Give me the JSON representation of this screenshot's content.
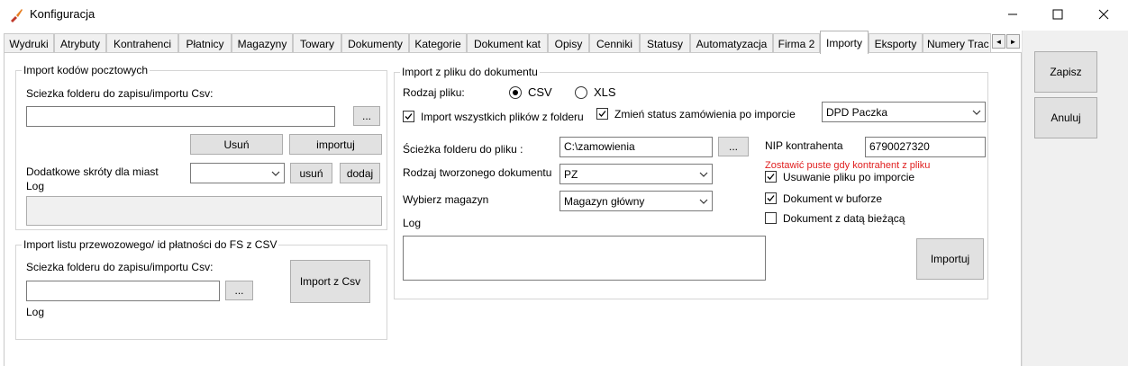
{
  "window": {
    "title": "Konfiguracja",
    "minimize_icon": "minimize-icon",
    "maximize_icon": "maximize-icon",
    "close_icon": "close-icon",
    "app_icon": "brush-icon"
  },
  "tabs": [
    {
      "label": "Wydruki"
    },
    {
      "label": "Atrybuty"
    },
    {
      "label": "Kontrahenci"
    },
    {
      "label": "Płatnicy"
    },
    {
      "label": "Magazyny"
    },
    {
      "label": "Towary"
    },
    {
      "label": "Dokumenty"
    },
    {
      "label": "Kategorie"
    },
    {
      "label": "Dokument kat"
    },
    {
      "label": "Opisy"
    },
    {
      "label": "Cenniki"
    },
    {
      "label": "Statusy"
    },
    {
      "label": "Automatyzacja"
    },
    {
      "label": "Firma 2"
    },
    {
      "label": "Importy",
      "active": true
    },
    {
      "label": "Eksporty"
    },
    {
      "label": "Numery Trac"
    }
  ],
  "tab_scroll": {
    "left": "◄",
    "right": "►"
  },
  "postal": {
    "group_title": "Import kodów pocztowych",
    "path_label": "Sciezka folderu do zapisu/importu Csv:",
    "path_value": "",
    "browse": "...",
    "remove": "Usuń",
    "import": "importuj",
    "shortcuts_label": "Dodatkowe skróty dla miast",
    "shortcuts_value": "",
    "shortcut_remove": "usuń",
    "shortcut_add": "dodaj",
    "log_label": "Log"
  },
  "waybill": {
    "group_title": "Import listu przewozowego/ id płatności do FS z CSV",
    "path_label": "Sciezka folderu do zapisu/importu Csv:",
    "path_value": "",
    "browse": "...",
    "import_button": "Import z Csv",
    "log_label": "Log"
  },
  "docimport": {
    "group_title": "Import z pliku do dokumentu",
    "file_type_label": "Rodzaj pliku:",
    "radio_csv": "CSV",
    "radio_xls": "XLS",
    "file_type_selected": "CSV",
    "import_all_label": "Import wszystkich plików z folderu",
    "import_all_checked": true,
    "change_status_label": "Zmień status zamówienia po imporcie",
    "change_status_checked": true,
    "status_value": "DPD Paczka",
    "path_label": "Ścieżka folderu do pliku :",
    "path_value": "C:\\zamowienia",
    "browse": "...",
    "nip_label": "NIP kontrahenta",
    "nip_value": "6790027320",
    "nip_hint": "Zostawić puste gdy kontrahent z pliku",
    "doc_type_label": "Rodzaj tworzonego dokumentu",
    "doc_type_value": "PZ",
    "warehouse_label": "Wybierz magazyn",
    "warehouse_value": "Magazyn główny",
    "delete_file_label": "Usuwanie pliku po imporcie",
    "delete_file_checked": true,
    "buffer_label": "Dokument w buforze",
    "buffer_checked": true,
    "current_date_label": "Dokument z datą bieżącą",
    "current_date_checked": false,
    "log_label": "Log",
    "import_button": "Importuj"
  },
  "side": {
    "save": "Zapisz",
    "cancel": "Anuluj"
  }
}
